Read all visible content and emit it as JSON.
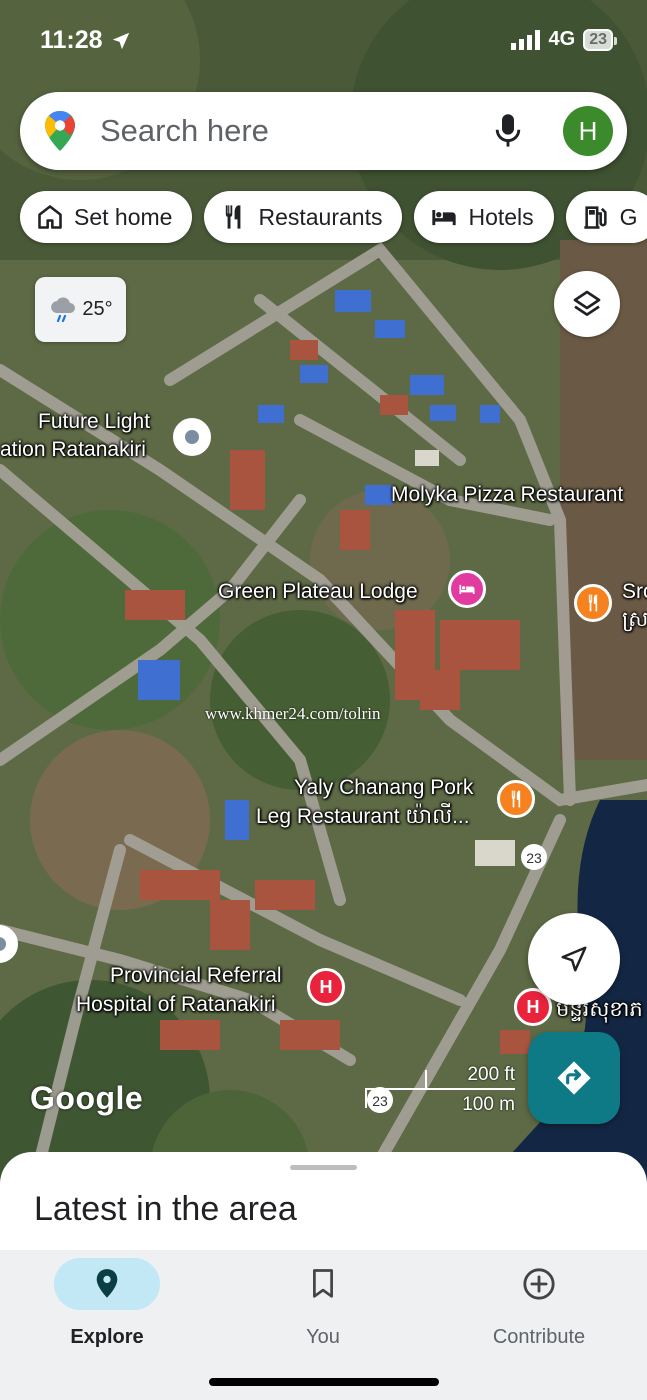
{
  "status_bar": {
    "time": "11:28",
    "network": "4G",
    "battery": "23"
  },
  "search": {
    "placeholder": "Search here",
    "avatar_letter": "H"
  },
  "chips": [
    {
      "label": "Set home",
      "icon": "home-icon"
    },
    {
      "label": "Restaurants",
      "icon": "fork-knife-icon"
    },
    {
      "label": "Hotels",
      "icon": "bed-icon"
    },
    {
      "label": "G",
      "icon": "gas-pump-icon"
    }
  ],
  "weather": {
    "temp": "25°"
  },
  "map": {
    "pois": [
      {
        "lines": [
          "Future Light",
          "ation Ratanakiri"
        ],
        "type": "place"
      },
      {
        "lines": [
          "Molyka Pizza Restaurant"
        ],
        "type": "label"
      },
      {
        "lines": [
          "Green Plateau Lodge"
        ],
        "type": "hotel"
      },
      {
        "lines": [
          "Sro",
          "ស្រ"
        ],
        "type": "restaurant"
      },
      {
        "lines": [
          "Yaly Chanang Pork",
          "Leg Restaurant យ៉ាលី..."
        ],
        "type": "restaurant"
      },
      {
        "lines": [
          "Provincial Referral",
          "Hospital of Ratanakiri"
        ],
        "type": "hospital"
      },
      {
        "lines": [
          "មន្ទីរសុខាភ"
        ],
        "type": "hospital"
      }
    ],
    "road_badges": [
      "23",
      "23"
    ],
    "watermark": "www.khmer24.com/tolrin",
    "attribution": "Google",
    "scale": {
      "imperial": "200 ft",
      "metric": "100 m"
    }
  },
  "sheet": {
    "title": "Latest in the area"
  },
  "nav": [
    {
      "label": "Explore",
      "icon": "explore-pin-icon",
      "active": true
    },
    {
      "label": "You",
      "icon": "bookmark-icon",
      "active": false
    },
    {
      "label": "Contribute",
      "icon": "plus-circle-icon",
      "active": false
    }
  ],
  "colors": {
    "accent": "#0e7a86",
    "explore_pill": "#c2e8f5",
    "avatar": "#3b8a2b"
  }
}
